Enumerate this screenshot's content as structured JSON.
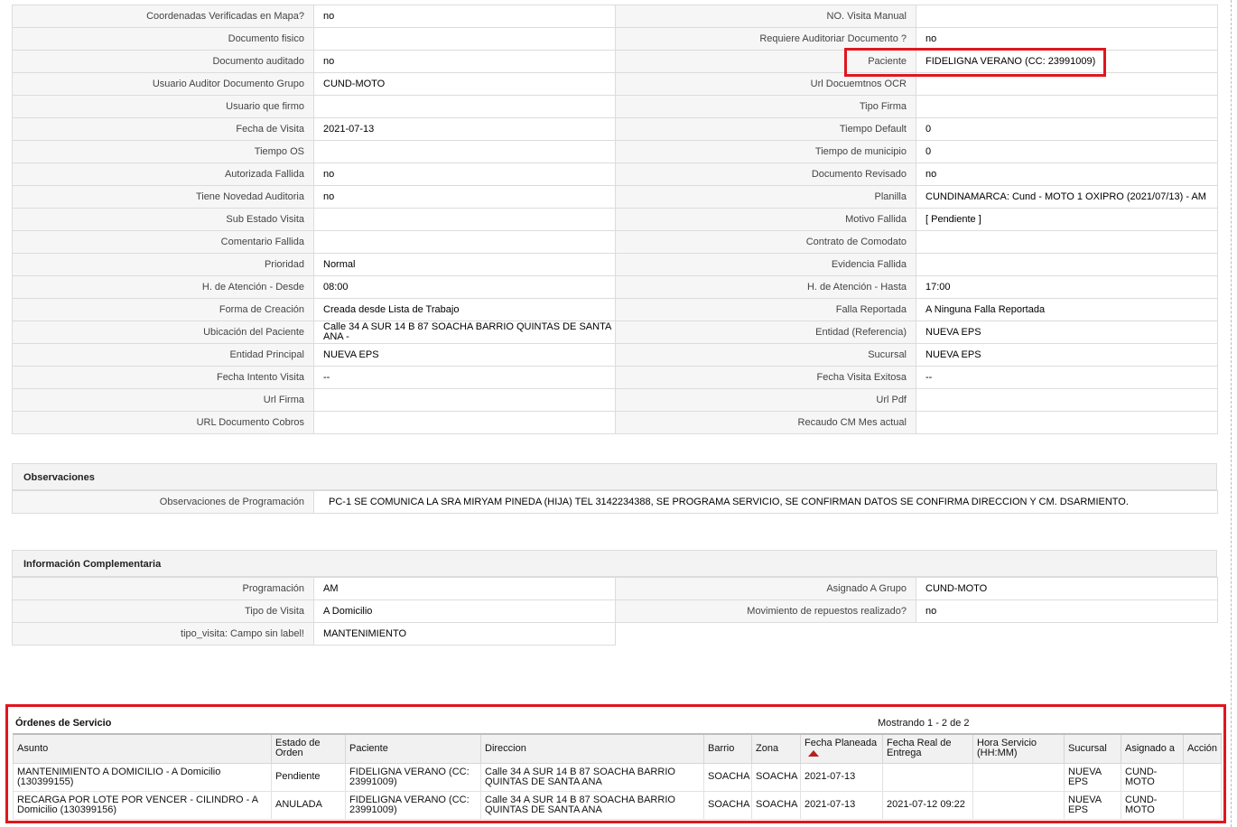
{
  "details": {
    "rows": [
      [
        {
          "l": "Coordenadas Verificadas en Mapa?",
          "v": "no"
        },
        {
          "l": "NO. Visita Manual",
          "v": ""
        }
      ],
      [
        {
          "l": "Documento fisico",
          "v": ""
        },
        {
          "l": "Requiere Auditoriar Documento ?",
          "v": "no"
        }
      ],
      [
        {
          "l": "Documento auditado",
          "v": "no"
        },
        {
          "l": "Paciente",
          "v": "FIDELIGNA VERANO (CC: 23991009)"
        }
      ],
      [
        {
          "l": "Usuario Auditor Documento Grupo",
          "v": "CUND-MOTO"
        },
        {
          "l": "Url Docuemtnos OCR",
          "v": ""
        }
      ],
      [
        {
          "l": "Usuario que firmo",
          "v": ""
        },
        {
          "l": "Tipo Firma",
          "v": ""
        }
      ],
      [
        {
          "l": "Fecha de Visita",
          "v": "2021-07-13"
        },
        {
          "l": "Tiempo Default",
          "v": "0"
        }
      ],
      [
        {
          "l": "Tiempo OS",
          "v": ""
        },
        {
          "l": "Tiempo de municipio",
          "v": "0"
        }
      ],
      [
        {
          "l": "Autorizada Fallida",
          "v": "no"
        },
        {
          "l": "Documento Revisado",
          "v": "no"
        }
      ],
      [
        {
          "l": "Tiene Novedad Auditoria",
          "v": "no"
        },
        {
          "l": "Planilla",
          "v": "CUNDINAMARCA: Cund - MOTO 1 OXIPRO (2021/07/13) - AM"
        }
      ],
      [
        {
          "l": "Sub Estado Visita",
          "v": ""
        },
        {
          "l": "Motivo Fallida",
          "v": "[ Pendiente ]"
        }
      ],
      [
        {
          "l": "Comentario Fallida",
          "v": ""
        },
        {
          "l": "Contrato de Comodato",
          "v": ""
        }
      ],
      [
        {
          "l": "Prioridad",
          "v": "Normal"
        },
        {
          "l": "Evidencia Fallida",
          "v": ""
        }
      ],
      [
        {
          "l": "H. de Atención - Desde",
          "v": "08:00"
        },
        {
          "l": "H. de Atención - Hasta",
          "v": "17:00"
        }
      ],
      [
        {
          "l": "Forma de Creación",
          "v": "Creada desde Lista de Trabajo"
        },
        {
          "l": "Falla Reportada",
          "v": "A Ninguna Falla Reportada"
        }
      ],
      [
        {
          "l": "Ubicación del Paciente",
          "v": "Calle 34 A SUR 14 B 87 SOACHA BARRIO QUINTAS DE SANTA ANA -"
        },
        {
          "l": "Entidad (Referencia)",
          "v": "NUEVA EPS"
        }
      ],
      [
        {
          "l": "Entidad Principal",
          "v": "NUEVA EPS"
        },
        {
          "l": "Sucursal",
          "v": "NUEVA EPS"
        }
      ],
      [
        {
          "l": "Fecha Intento Visita",
          "v": "--"
        },
        {
          "l": "Fecha Visita Exitosa",
          "v": "--"
        }
      ],
      [
        {
          "l": "Url Firma",
          "v": ""
        },
        {
          "l": "Url Pdf",
          "v": ""
        }
      ],
      [
        {
          "l": "URL Documento Cobros",
          "v": ""
        },
        {
          "l": "Recaudo CM Mes actual",
          "v": ""
        }
      ]
    ]
  },
  "observaciones": {
    "title": "Observaciones",
    "label": "Observaciones de Programación",
    "value": "PC-1 SE COMUNICA LA SRA MIRYAM PINEDA (HIJA) TEL 3142234388, SE PROGRAMA SERVICIO, SE CONFIRMAN DATOS SE CONFIRMA DIRECCION Y CM. DSARMIENTO."
  },
  "info": {
    "title": "Información Complementaria",
    "rows": [
      [
        {
          "l": "Programación",
          "v": "AM"
        },
        {
          "l": "Asignado A Grupo",
          "v": "CUND-MOTO"
        }
      ],
      [
        {
          "l": "Tipo de Visita",
          "v": "A Domicilio"
        },
        {
          "l": "Movimiento de repuestos realizado?",
          "v": "no"
        }
      ],
      [
        {
          "l": "tipo_visita: Campo sin label!",
          "v": "MANTENIMIENTO"
        }
      ]
    ]
  },
  "orders": {
    "title": "Órdenes de Servicio",
    "count": "Mostrando 1 - 2 de 2",
    "columns": [
      "Asunto",
      "Estado de Orden",
      "Paciente",
      "Direccion",
      "Barrio",
      "Zona",
      "Fecha Planeada",
      "Fecha Real de Entrega",
      "Hora Servicio (HH:MM)",
      "Sucursal",
      "Asignado a",
      "Acción"
    ],
    "rows": [
      [
        "MANTENIMIENTO A DOMICILIO - A Domicilio (130399155)",
        "Pendiente",
        "FIDELIGNA VERANO (CC: 23991009)",
        "Calle 34 A SUR 14 B 87 SOACHA BARRIO QUINTAS DE SANTA ANA",
        "SOACHA",
        "SOACHA",
        "2021-07-13",
        "",
        "",
        "NUEVA EPS",
        "CUND-MOTO",
        ""
      ],
      [
        "RECARGA POR LOTE POR VENCER - CILINDRO - A Domicilio (130399156)",
        "ANULADA",
        "FIDELIGNA VERANO (CC: 23991009)",
        "Calle 34 A SUR 14 B 87 SOACHA BARRIO QUINTAS DE SANTA ANA",
        "SOACHA",
        "SOACHA",
        "2021-07-13",
        "2021-07-12 09:22",
        "",
        "NUEVA EPS",
        "CUND-MOTO",
        ""
      ]
    ]
  },
  "colors": {
    "highlight": "#e0161e",
    "label_bg": "#f6f6f6",
    "border": "#dcdcdc"
  }
}
